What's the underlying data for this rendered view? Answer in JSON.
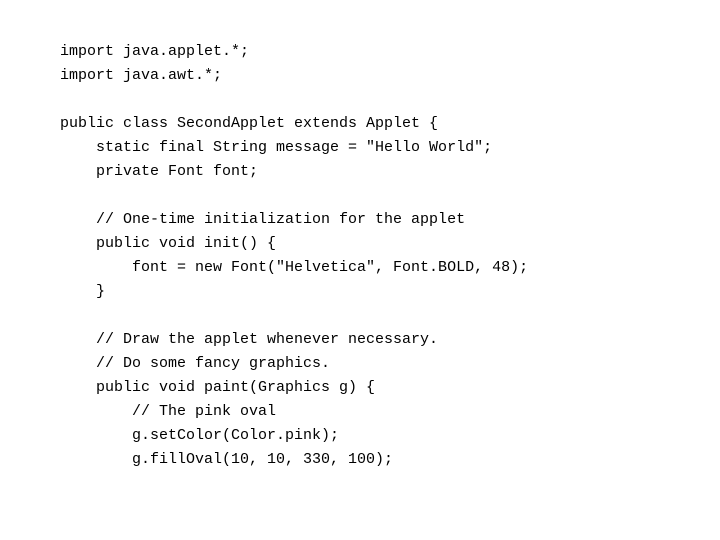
{
  "code": {
    "lines": [
      "import java.applet.*;",
      "import java.awt.*;",
      "",
      "public class SecondApplet extends Applet {",
      "    static final String message = \"Hello World\";",
      "    private Font font;",
      "",
      "    // One-time initialization for the applet",
      "    public void init() {",
      "        font = new Font(\"Helvetica\", Font.BOLD, 48);",
      "    }",
      "",
      "    // Draw the applet whenever necessary.",
      "    // Do some fancy graphics.",
      "    public void paint(Graphics g) {",
      "        // The pink oval",
      "        g.setColor(Color.pink);",
      "        g.fillOval(10, 10, 330, 100);"
    ]
  }
}
